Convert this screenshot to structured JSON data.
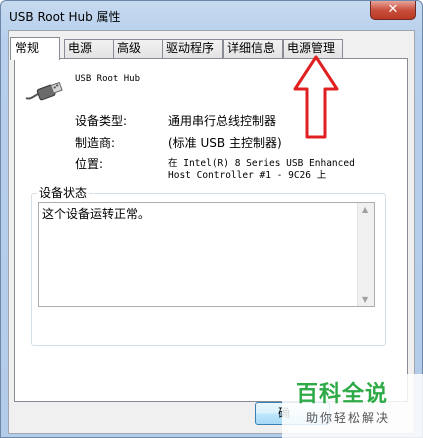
{
  "window": {
    "title": "USB Root Hub 属性",
    "close_glyph": "✕"
  },
  "tabs": [
    {
      "label": "常规"
    },
    {
      "label": "电源"
    },
    {
      "label": "高级"
    },
    {
      "label": "驱动程序"
    },
    {
      "label": "详细信息"
    },
    {
      "label": "电源管理"
    }
  ],
  "device": {
    "name": "USB Root Hub"
  },
  "properties": {
    "type_label": "设备类型:",
    "type_value": "通用串行总线控制器",
    "mfr_label": "制造商:",
    "mfr_value": "(标准 USB 主控制器)",
    "loc_label": "位置:",
    "loc_line1": "在 Intel(R) 8 Series USB Enhanced",
    "loc_line2": "Host Controller #1 - 9C26 上"
  },
  "status": {
    "group_label": "设备状态",
    "text": "这个设备运转正常。"
  },
  "buttons": {
    "ok": "确"
  },
  "watermark": {
    "main": "百科全说",
    "sub": "助你轻松解决"
  },
  "colors": {
    "annotation_arrow": "#e02020",
    "watermark_green": "#2eaa47"
  }
}
